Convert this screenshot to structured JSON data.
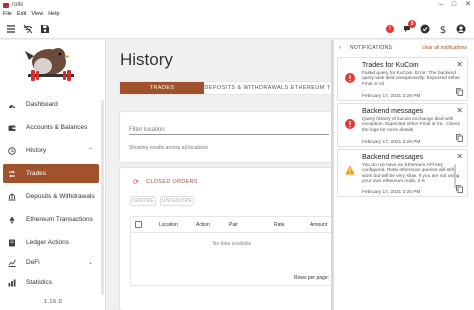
{
  "window": {
    "title": "rotki",
    "controls": [
      "–",
      "□",
      "✕"
    ]
  },
  "menu": [
    "File",
    "Edit",
    "View",
    "Help"
  ],
  "toolbar": {
    "notification_count": "3",
    "left_icons": [
      "menu-icon",
      "wifi-off-icon",
      "save-icon"
    ],
    "right_icons": [
      "notifications-icon",
      "check-circle-icon",
      "dollar-icon",
      "account-circle-icon"
    ]
  },
  "sidebar": {
    "items": [
      {
        "label": "Dashboard",
        "icon": "dashboard-icon",
        "has_chevron": false
      },
      {
        "label": "Accounts & Balances",
        "icon": "wallet-icon",
        "has_chevron": false
      },
      {
        "label": "History",
        "icon": "history-icon",
        "has_chevron": true,
        "chevron": "⌃"
      },
      {
        "label": "Trades",
        "icon": "swap-icon",
        "has_chevron": false,
        "active": true
      },
      {
        "label": "Deposits & Withdrawals",
        "icon": "bank-transfer-icon",
        "has_chevron": false
      },
      {
        "label": "Ethereum Transactions",
        "icon": "ethereum-icon",
        "has_chevron": false
      },
      {
        "label": "Ledger Actions",
        "icon": "book-icon",
        "has_chevron": false
      },
      {
        "label": "DeFi",
        "icon": "finance-icon",
        "has_chevron": true,
        "chevron": "⌄"
      },
      {
        "label": "Statistics",
        "icon": "chart-icon",
        "has_chevron": false
      }
    ],
    "version": "1.16.0"
  },
  "main": {
    "title": "History",
    "tabs": [
      "TRADES",
      "DEPOSITS & WITHDRAWALS",
      "ETHEREUM T"
    ],
    "filter": {
      "placeholder": "Filter location",
      "hint": "Showing results across all locations"
    },
    "orders": {
      "header": "CLOSED ORDERS",
      "ignore_label": "IGNORE",
      "unignore_label": "UNIGNORE",
      "columns": [
        "Location",
        "Action",
        "Pair",
        "Rate",
        "Amount"
      ],
      "no_data": "No data available",
      "rows_per_page": "Rows per page:"
    }
  },
  "notifications": {
    "header": "NOTIFICATIONS",
    "clear_all": "clear all notifications",
    "items": [
      {
        "title": "Trades for KuCoin",
        "body": "Failed query for KuCoin. Error: The backend query task died unexpectedly: Expected either Final or int",
        "date": "February 17, 2021 3:29 PM",
        "severity": "error",
        "color": "#e53935"
      },
      {
        "title": "Backend messages",
        "body": "Query history of kucoin exchange died with exception: Expected either Final or int.. Check the logs for more details",
        "date": "February 17, 2021 3:29 PM",
        "severity": "error",
        "color": "#e53935"
      },
      {
        "title": "Backend messages",
        "body": "You do not have an Ethereum API key configured. Rotki etherscan queries will still work but will be very slow. If you are not using your own ethereum node, it is",
        "date": "February 17, 2021 3:25 PM",
        "severity": "warning",
        "color": "#f59b00"
      }
    ]
  },
  "colors": {
    "accent": "#a0522d",
    "error": "#e53935",
    "warning": "#f59b00"
  }
}
